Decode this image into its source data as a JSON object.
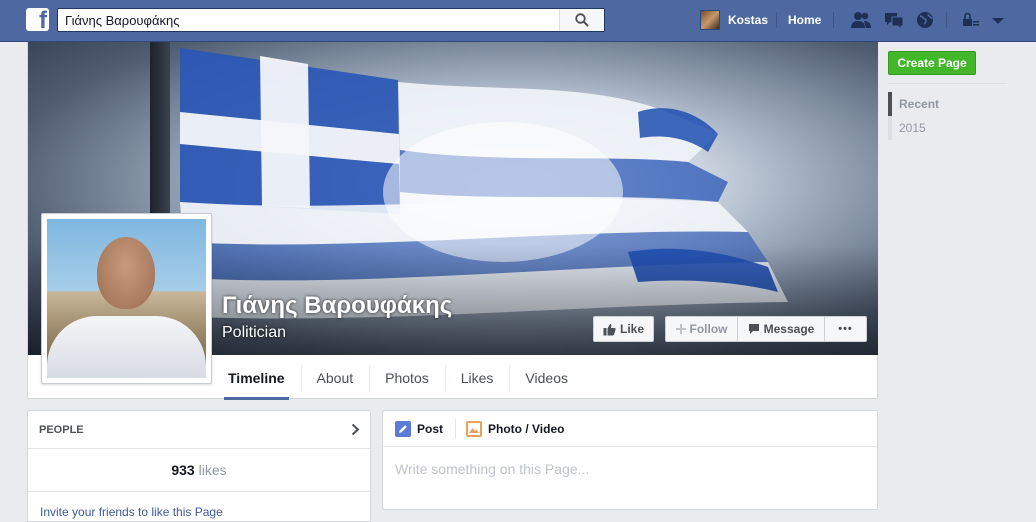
{
  "topbar": {
    "logo": "f",
    "search_value": "Γιάνης Βαρουφάκης",
    "profile_name": "Kostas",
    "home_label": "Home"
  },
  "page": {
    "name": "Γιάνης Βαρουφάκης",
    "category": "Politician"
  },
  "actions": {
    "like": "Like",
    "follow": "Follow",
    "message": "Message",
    "more": "•••"
  },
  "tabs": [
    "Timeline",
    "About",
    "Photos",
    "Likes",
    "Videos"
  ],
  "right": {
    "create_page": "Create Page",
    "years": [
      "Recent",
      "2015"
    ]
  },
  "people": {
    "header": "PEOPLE",
    "likes_count": "933",
    "likes_word": "likes",
    "invite": "Invite your friends to like this Page"
  },
  "composer": {
    "post_label": "Post",
    "photo_label": "Photo / Video",
    "placeholder": "Write something on this Page..."
  },
  "colors": {
    "topbar": "#4e69a2",
    "create_page": "#42b72a",
    "flag_blue": "#1f4fb0"
  }
}
